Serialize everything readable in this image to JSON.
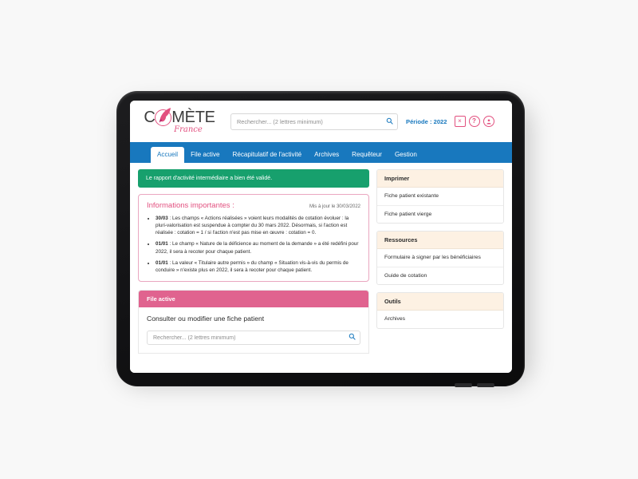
{
  "header": {
    "logo": {
      "prefix": "C",
      "suffix": "MÈTE",
      "subtitle": "France",
      "mark": "comet-icon"
    },
    "search": {
      "placeholder": "Rechercher... (2 lettres minimum)",
      "value": "",
      "icon": "search-icon"
    },
    "period_label": "Période : 2022",
    "close_label": "×",
    "help_label": "?",
    "account_label": "●"
  },
  "nav": {
    "items": [
      {
        "label": "Accueil",
        "active": true
      },
      {
        "label": "File active",
        "active": false
      },
      {
        "label": "Récapitulatif de l'activité",
        "active": false
      },
      {
        "label": "Archives",
        "active": false
      },
      {
        "label": "Requêteur",
        "active": false
      },
      {
        "label": "Gestion",
        "active": false
      }
    ]
  },
  "main": {
    "alert": "Le rapport d'activité intermédiaire a bien été validé.",
    "info": {
      "title": "Informations importantes :",
      "updated": "Mis à jour le 30/03/2022",
      "items": [
        {
          "date": "30/03",
          "text": " : Les champs « Actions réalisées » voient leurs modalités de cotation évoluer : la pluri-valorisation est suspendue à compter du 30 mars 2022. Désormais, si l'action est réalisée : cotation = 1 / si l'action n'est pas mise en œuvre : cotation = 0."
        },
        {
          "date": "01/01",
          "text": " : Le champ « Nature de la déficience au moment de la demande » a été redéfini pour 2022, il sera à recoter pour chaque patient."
        },
        {
          "date": "01/01",
          "text": " : La valeur « Titulaire autre permis » du champ « Situation vis-à-vis du permis de conduire » n'existe plus en 2022, il sera à recoter pour chaque patient."
        }
      ]
    },
    "file_active": {
      "header": "File active",
      "title": "Consulter ou modifier une fiche patient",
      "search_placeholder": "Rechercher... (2 lettres minimum)",
      "search_value": "",
      "search_icon": "search-icon"
    }
  },
  "sidebar": {
    "cards": [
      {
        "title": "Imprimer",
        "items": [
          "Fiche patient existante",
          "Fiche patient vierge"
        ]
      },
      {
        "title": "Ressources",
        "items": [
          "Formulaire à signer par les bénéficiaires",
          "Guide de cotation"
        ]
      },
      {
        "title": "Outils",
        "items": [
          "Archives"
        ]
      }
    ]
  },
  "colors": {
    "blue": "#1878be",
    "pink": "#e2507f",
    "pink_header": "#e0638f",
    "green": "#17a06d",
    "cream": "#fdf1e3"
  }
}
